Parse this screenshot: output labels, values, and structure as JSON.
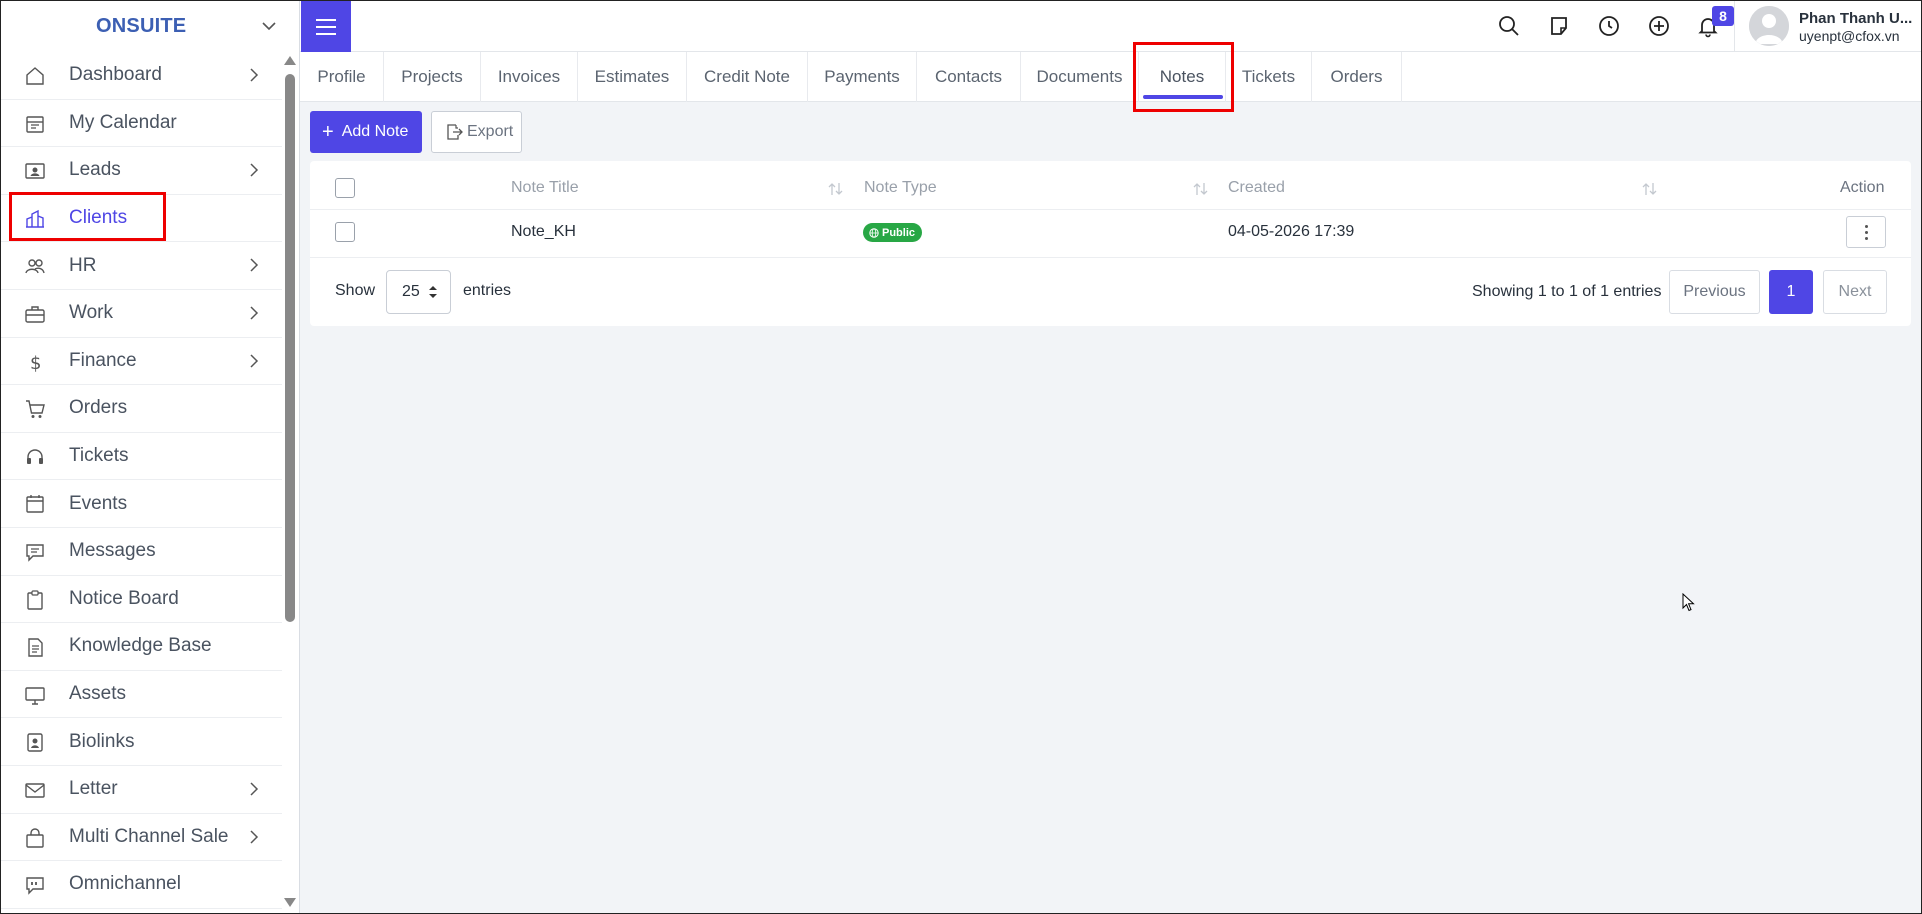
{
  "sidebar": {
    "brand": "ONSUITE",
    "items": [
      {
        "label": "Dashboard",
        "icon": "home-icon",
        "has_submenu": true
      },
      {
        "label": "My Calendar",
        "icon": "calendar-icon",
        "has_submenu": false
      },
      {
        "label": "Leads",
        "icon": "contact-card-icon",
        "has_submenu": true
      },
      {
        "label": "Clients",
        "icon": "building-icon",
        "has_submenu": false,
        "active": true
      },
      {
        "label": "HR",
        "icon": "people-icon",
        "has_submenu": true
      },
      {
        "label": "Work",
        "icon": "briefcase-icon",
        "has_submenu": true
      },
      {
        "label": "Finance",
        "icon": "dollar-icon",
        "has_submenu": true
      },
      {
        "label": "Orders",
        "icon": "cart-icon",
        "has_submenu": false
      },
      {
        "label": "Tickets",
        "icon": "headset-icon",
        "has_submenu": false
      },
      {
        "label": "Events",
        "icon": "calendar-event-icon",
        "has_submenu": false
      },
      {
        "label": "Messages",
        "icon": "message-icon",
        "has_submenu": false
      },
      {
        "label": "Notice Board",
        "icon": "clipboard-icon",
        "has_submenu": false
      },
      {
        "label": "Knowledge Base",
        "icon": "document-icon",
        "has_submenu": false
      },
      {
        "label": "Assets",
        "icon": "monitor-icon",
        "has_submenu": false
      },
      {
        "label": "Biolinks",
        "icon": "badge-person-icon",
        "has_submenu": false
      },
      {
        "label": "Letter",
        "icon": "envelope-icon",
        "has_submenu": true
      },
      {
        "label": "Multi Channel Sale",
        "icon": "bag-icon",
        "has_submenu": true
      },
      {
        "label": "Omnichannel",
        "icon": "chat-quote-icon",
        "has_submenu": false
      }
    ]
  },
  "header": {
    "notification_count": "8",
    "user_name": "Phan Thanh U...",
    "user_email": "uyenpt@cfox.vn"
  },
  "tabs": [
    "Profile",
    "Projects",
    "Invoices",
    "Estimates",
    "Credit Note",
    "Payments",
    "Contacts",
    "Documents",
    "Notes",
    "Tickets",
    "Orders"
  ],
  "active_tab": "Notes",
  "actions": {
    "add_label": "Add Note",
    "export_label": "Export"
  },
  "table": {
    "columns": {
      "title": "Note Title",
      "type": "Note Type",
      "created": "Created",
      "action": "Action"
    },
    "rows": [
      {
        "title": "Note_KH",
        "type": "Public",
        "created": "04-05-2026 17:39"
      }
    ]
  },
  "footer": {
    "show_label": "Show",
    "page_size": "25",
    "entries_label": "entries",
    "showing_text": "Showing 1 to 1 of 1 entries",
    "prev_label": "Previous",
    "current_page": "1",
    "next_label": "Next"
  },
  "colors": {
    "accent": "#4f46e5",
    "brand": "#3c5fb3",
    "highlight_box": "#ee0000",
    "public_badge": "#28a745"
  }
}
